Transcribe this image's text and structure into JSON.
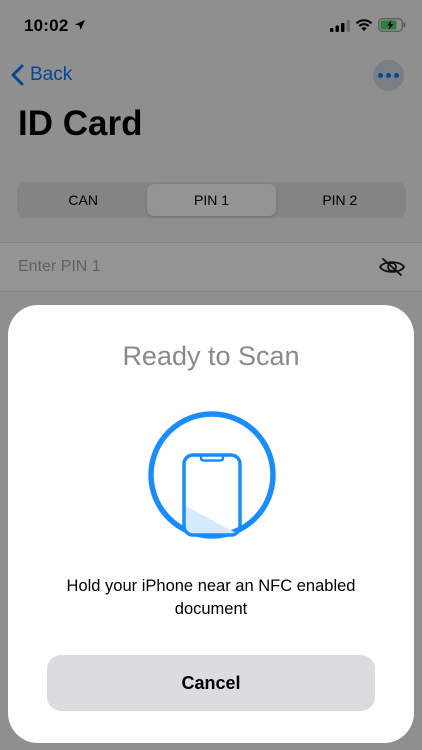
{
  "status_bar": {
    "time": "10:02",
    "icons": [
      "location-arrow-icon",
      "cellular-signal-icon",
      "wifi-icon",
      "battery-charging-icon"
    ]
  },
  "nav": {
    "back_label": "Back",
    "more_icon": "ellipsis-icon"
  },
  "page": {
    "title": "ID Card"
  },
  "segmented": {
    "items": [
      {
        "label": "CAN"
      },
      {
        "label": "PIN 1"
      },
      {
        "label": "PIN 2"
      }
    ],
    "selected": "PIN 1"
  },
  "pin_field": {
    "placeholder": "Enter PIN 1",
    "value": "",
    "visibility_icon": "eye-slash-icon"
  },
  "nfc_sheet": {
    "title": "Ready to Scan",
    "message": "Hold your iPhone near an NFC enabled document",
    "cancel_label": "Cancel",
    "graphic_icon": "phone-nfc-scan-icon"
  },
  "colors": {
    "accent": "#0a7aff",
    "sheet_title": "#8a8a8e",
    "cancel_bg": "#dcdce0",
    "battery": "#4cd964"
  }
}
